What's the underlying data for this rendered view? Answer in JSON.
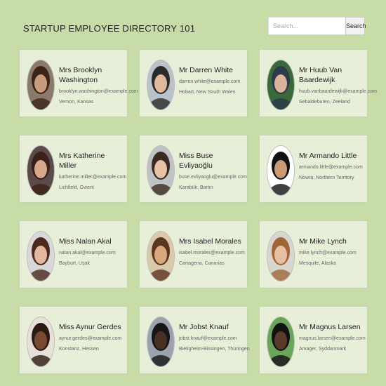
{
  "header": {
    "title": "STARTUP EMPLOYEE DIRECTORY 101",
    "search_placeholder": "Search...",
    "search_button": "Search"
  },
  "employees": [
    {
      "name": "Mrs Brooklyn Washington",
      "email": "brooklyn.washington@example.com",
      "location": "Vernon, Kansas",
      "skin": "#c99b7d",
      "hair": "#3a2418",
      "bg": "#8a7a6a"
    },
    {
      "name": "Mr Darren White",
      "email": "darren.white@example.com",
      "location": "Hobart, New South Wales",
      "skin": "#e0b89a",
      "hair": "#2a2a2a",
      "bg": "#b9c1c9"
    },
    {
      "name": "Mr Huub Van Baardewijk",
      "email": "huub.vanbaardewijk@example.com",
      "location": "Sebaldeburen, Zeeland",
      "skin": "#d9b39a",
      "hair": "#2c3a4a",
      "bg": "#3a6a3a"
    },
    {
      "name": "Mrs Katherine Miller",
      "email": "katherine.miller@example.com",
      "location": "Lichfield, Gwent",
      "skin": "#d7a98a",
      "hair": "#3a2218",
      "bg": "#5a4a4a"
    },
    {
      "name": "Miss Buse Evliyaoğlu",
      "email": "buse.evliyaoglu@example.com",
      "location": "Karabük, Bartın",
      "skin": "#e6c2a6",
      "hair": "#3b2a1f",
      "bg": "#bfc2c4"
    },
    {
      "name": "Mr Armando Little",
      "email": "armando.little@example.com",
      "location": "Nowra, Northern Territory",
      "skin": "#c99a74",
      "hair": "#111111",
      "bg": "#ffffff"
    },
    {
      "name": "Miss Nalan Akal",
      "email": "nalan.akal@example.com",
      "location": "Bayburt, Uşak",
      "skin": "#e2b9a0",
      "hair": "#4a2a1f",
      "bg": "#d8d8d8"
    },
    {
      "name": "Mrs Isabel Morales",
      "email": "isabel.morales@example.com",
      "location": "Cartagena, Canarias",
      "skin": "#d9a77c",
      "hair": "#5a3520",
      "bg": "#d9c9a9"
    },
    {
      "name": "Mr Mike Lynch",
      "email": "mike.lynch@example.com",
      "location": "Mesquite, Alaska",
      "skin": "#e8bfa3",
      "hair": "#a0663a",
      "bg": "#d8d6cf"
    },
    {
      "name": "Miss Aynur Gerdes",
      "email": "aynur.gerdes@example.com",
      "location": "Konstanz, Hessen",
      "skin": "#7a4a30",
      "hair": "#2a1a12",
      "bg": "#e8e0d8"
    },
    {
      "name": "Mr Jobst Knauf",
      "email": "jobst.knauf@example.com",
      "location": "Bietigheim-Bissingen, Thüringen",
      "skin": "#4a3024",
      "hair": "#151515",
      "bg": "#9aa3ad"
    },
    {
      "name": "Mr Magnus Larsen",
      "email": "magnus.larsen@example.com",
      "location": "Amager, Syddanmark",
      "skin": "#5a3a28",
      "hair": "#111111",
      "bg": "#6aa35a"
    }
  ]
}
